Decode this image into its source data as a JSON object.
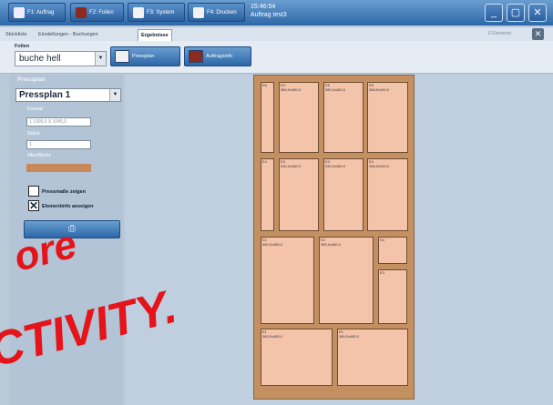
{
  "toolbar": {
    "buttons": [
      {
        "label": "F1: Auftrag",
        "icon": "order-icon"
      },
      {
        "label": "F2: Folien",
        "icon": "foil-icon"
      },
      {
        "label": "F3: System",
        "icon": "system-icon"
      },
      {
        "label": "F4: Drucken",
        "icon": "printer-icon"
      }
    ],
    "time": "15:46:54",
    "order": "Auftrag test3"
  },
  "tabs": [
    "Stückliste",
    "Einstellungen - Buchungen",
    "Ergebnisse"
  ],
  "active_tab": "Ergebnisse",
  "element_count": "6 Elemente",
  "folien": {
    "label": "Folien",
    "value": "buche hell"
  },
  "action_buttons": [
    {
      "label": "Pressplan",
      "icon": "press-icon"
    },
    {
      "label": "Auftragsinfo",
      "icon": "info-icon"
    }
  ],
  "sidebar": {
    "title": "Pressplan",
    "select_value": "Pressplan 1",
    "format_label": "Format",
    "format_value": "1 1905,0 X 1045,0",
    "stueck_label": "Stück",
    "stueck_value": "1",
    "surface_label": "Oberfläche",
    "checkbox1_label": "Pressmaße zeigen",
    "checkbox1_checked": false,
    "checkbox2_label": "Elementinfo anzeigen",
    "checkbox2_checked": true
  },
  "parts": [
    {
      "label": "E6"
    },
    {
      "label": "E5\n380,0x480,0"
    },
    {
      "label": "E5\n380,0x480,0"
    },
    {
      "label": "E5\n358,0x400,0"
    },
    {
      "label": "E4"
    },
    {
      "label": "E3\n250,0x480,0"
    },
    {
      "label": "E3\n250,0x480,0"
    },
    {
      "label": "E3\n358,0x400,0"
    },
    {
      "label": "E2\n380,0x480,0"
    },
    {
      "label": "E2\n380,0x480,0"
    },
    {
      "label": "E4"
    },
    {
      "label": "E3"
    },
    {
      "label": "E1\n380,0x480,0"
    },
    {
      "label": "E1\n380,0x480,0"
    }
  ],
  "overlay": {
    "line1": "ore",
    "line2": "CTIVITY."
  }
}
